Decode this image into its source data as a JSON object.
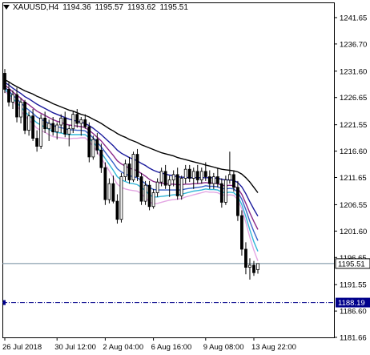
{
  "header": {
    "symbol": "XAUUSD,H4",
    "open": "1194.36",
    "high": "1195.57",
    "low": "1193.62",
    "close": "1195.51"
  },
  "colors": {
    "background": "#ffffff",
    "candle": "#000000",
    "price_line": "#6f8a9c",
    "level_line": "#00008b",
    "ma_black": "#000000",
    "ma_navy": "#1a1a9c",
    "ma_purple": "#8a2a8a",
    "ma_blue": "#3a62c9",
    "ma_cyan": "#34b7d8",
    "ma_pink": "#e3a6e3"
  },
  "chart_data": {
    "type": "candlestick",
    "ylim": [
      1181.66,
      1244.5
    ],
    "y_ticks": [
      "1241.65",
      "1236.70",
      "1231.60",
      "1226.65",
      "1221.55",
      "1216.60",
      "1211.65",
      "1206.55",
      "1201.60",
      "1196.65",
      "1191.55",
      "1186.60",
      "1181.66"
    ],
    "x_ticks": [
      "26 Jul 2018",
      "30 Jul 12:00",
      "2 Aug 04:00",
      "6 Aug 16:00",
      "9 Aug 08:00",
      "13 Aug 22:00"
    ],
    "current_price": {
      "label": "1195.51",
      "value": 1195.51
    },
    "level_line": {
      "label": "1188.19",
      "value": 1188.19
    },
    "candles": [
      [
        1231.2,
        1232.0,
        1227.5,
        1228.2
      ],
      [
        1228.2,
        1229.5,
        1225.0,
        1225.8
      ],
      [
        1225.8,
        1228.0,
        1224.5,
        1227.2
      ],
      [
        1227.2,
        1228.5,
        1222.0,
        1223.0
      ],
      [
        1223.0,
        1226.5,
        1221.8,
        1225.8
      ],
      [
        1225.8,
        1226.2,
        1219.8,
        1220.5
      ],
      [
        1220.5,
        1224.0,
        1219.5,
        1223.2
      ],
      [
        1223.2,
        1224.5,
        1218.5,
        1219.0
      ],
      [
        1219.0,
        1220.5,
        1216.5,
        1217.5
      ],
      [
        1217.5,
        1223.5,
        1217.0,
        1222.8
      ],
      [
        1222.8,
        1224.0,
        1220.0,
        1220.8
      ],
      [
        1220.8,
        1222.5,
        1218.5,
        1221.8
      ],
      [
        1221.8,
        1223.0,
        1219.5,
        1220.2
      ],
      [
        1220.2,
        1222.0,
        1218.8,
        1221.5
      ],
      [
        1221.5,
        1223.5,
        1220.0,
        1222.8
      ],
      [
        1222.8,
        1224.0,
        1219.2,
        1219.8
      ],
      [
        1219.8,
        1221.5,
        1217.5,
        1220.8
      ],
      [
        1220.8,
        1224.2,
        1220.0,
        1223.5
      ],
      [
        1223.5,
        1224.5,
        1221.0,
        1221.8
      ],
      [
        1221.8,
        1223.0,
        1219.5,
        1222.5
      ],
      [
        1222.5,
        1223.5,
        1220.8,
        1221.2
      ],
      [
        1221.2,
        1222.0,
        1214.5,
        1215.5
      ],
      [
        1215.5,
        1219.5,
        1215.0,
        1218.8
      ],
      [
        1218.8,
        1220.0,
        1216.0,
        1216.8
      ],
      [
        1216.8,
        1218.0,
        1212.5,
        1213.5
      ],
      [
        1213.5,
        1214.5,
        1206.5,
        1207.5
      ],
      [
        1207.5,
        1211.5,
        1206.8,
        1210.5
      ],
      [
        1210.5,
        1212.0,
        1206.8,
        1207.2
      ],
      [
        1207.2,
        1208.5,
        1203.0,
        1203.8
      ],
      [
        1203.8,
        1212.5,
        1203.2,
        1211.8
      ],
      [
        1211.8,
        1215.0,
        1211.0,
        1214.2
      ],
      [
        1214.2,
        1215.5,
        1210.5,
        1211.2
      ],
      [
        1211.2,
        1216.5,
        1210.8,
        1216.0
      ],
      [
        1216.0,
        1217.0,
        1211.0,
        1211.8
      ],
      [
        1211.8,
        1212.5,
        1206.5,
        1207.2
      ],
      [
        1207.2,
        1211.0,
        1206.5,
        1210.2
      ],
      [
        1210.2,
        1211.0,
        1205.5,
        1206.2
      ],
      [
        1206.2,
        1209.5,
        1205.8,
        1208.8
      ],
      [
        1208.8,
        1211.5,
        1208.0,
        1210.8
      ],
      [
        1210.8,
        1213.5,
        1210.0,
        1212.8
      ],
      [
        1212.8,
        1214.0,
        1209.5,
        1210.2
      ],
      [
        1210.2,
        1212.0,
        1208.0,
        1211.2
      ],
      [
        1211.2,
        1213.0,
        1210.0,
        1212.2
      ],
      [
        1212.2,
        1213.5,
        1207.5,
        1208.2
      ],
      [
        1208.2,
        1212.0,
        1207.5,
        1211.5
      ],
      [
        1211.5,
        1214.0,
        1210.5,
        1213.2
      ],
      [
        1213.2,
        1214.0,
        1210.8,
        1211.5
      ],
      [
        1211.5,
        1213.5,
        1209.5,
        1212.8
      ],
      [
        1212.8,
        1214.0,
        1210.5,
        1211.2
      ],
      [
        1211.2,
        1213.5,
        1210.5,
        1212.8
      ],
      [
        1212.8,
        1214.5,
        1211.0,
        1211.8
      ],
      [
        1211.8,
        1213.0,
        1209.5,
        1210.5
      ],
      [
        1210.5,
        1212.5,
        1209.5,
        1211.8
      ],
      [
        1211.8,
        1213.5,
        1209.8,
        1210.5
      ],
      [
        1210.5,
        1211.5,
        1206.0,
        1207.0
      ],
      [
        1207.0,
        1212.0,
        1206.5,
        1211.2
      ],
      [
        1211.2,
        1216.5,
        1210.5,
        1212.2
      ],
      [
        1212.2,
        1213.0,
        1209.0,
        1209.8
      ],
      [
        1209.8,
        1211.0,
        1203.5,
        1204.5
      ],
      [
        1204.5,
        1205.5,
        1197.0,
        1198.2
      ],
      [
        1198.2,
        1199.5,
        1193.5,
        1194.8
      ],
      [
        1194.8,
        1196.5,
        1192.5,
        1195.2
      ],
      [
        1195.2,
        1196.0,
        1193.2,
        1193.8
      ],
      [
        1194.36,
        1195.57,
        1193.62,
        1195.51
      ]
    ],
    "moving_averages": [
      {
        "color_key": "ma_black",
        "values": [
          1230.0,
          1229.6,
          1229.1,
          1228.7,
          1228.3,
          1227.9,
          1227.6,
          1227.3,
          1226.9,
          1226.6,
          1226.2,
          1225.9,
          1225.5,
          1225.2,
          1224.9,
          1224.6,
          1224.3,
          1224.1,
          1223.8,
          1223.5,
          1223.3,
          1223.0,
          1222.6,
          1222.2,
          1221.8,
          1221.3,
          1220.8,
          1220.4,
          1219.9,
          1219.5,
          1219.2,
          1218.8,
          1218.5,
          1218.2,
          1217.8,
          1217.5,
          1217.2,
          1216.9,
          1216.6,
          1216.3,
          1216.1,
          1215.9,
          1215.7,
          1215.4,
          1215.2,
          1215.0,
          1214.8,
          1214.6,
          1214.4,
          1214.2,
          1214.0,
          1213.8,
          1213.6,
          1213.4,
          1213.2,
          1213.1,
          1213.0,
          1212.9,
          1212.7,
          1212.3,
          1211.6,
          1210.8,
          1209.8,
          1208.8
        ]
      },
      {
        "color_key": "ma_navy",
        "values": [
          1229.5,
          1229.0,
          1228.4,
          1227.9,
          1227.4,
          1226.8,
          1226.4,
          1225.9,
          1225.4,
          1225.0,
          1224.6,
          1224.2,
          1223.8,
          1223.5,
          1223.2,
          1222.9,
          1222.6,
          1222.4,
          1222.2,
          1222.0,
          1221.8,
          1221.4,
          1220.9,
          1220.3,
          1219.7,
          1219.0,
          1218.3,
          1217.6,
          1216.8,
          1216.2,
          1215.8,
          1215.4,
          1215.1,
          1214.8,
          1214.3,
          1213.9,
          1213.4,
          1213.0,
          1212.7,
          1212.5,
          1212.3,
          1212.1,
          1212.0,
          1211.8,
          1211.7,
          1211.7,
          1211.6,
          1211.6,
          1211.6,
          1211.6,
          1211.6,
          1211.6,
          1211.6,
          1211.5,
          1211.3,
          1211.2,
          1211.2,
          1211.1,
          1210.7,
          1209.9,
          1208.6,
          1207.1,
          1205.7,
          1204.4
        ]
      },
      {
        "color_key": "ma_purple",
        "values": [
          1229.0,
          1228.4,
          1227.7,
          1227.1,
          1226.5,
          1225.8,
          1225.3,
          1224.7,
          1224.1,
          1223.7,
          1223.3,
          1222.9,
          1222.5,
          1222.2,
          1222.0,
          1221.7,
          1221.5,
          1221.4,
          1221.3,
          1221.2,
          1221.0,
          1220.5,
          1219.9,
          1219.2,
          1218.5,
          1217.6,
          1216.7,
          1215.8,
          1214.8,
          1214.2,
          1213.8,
          1213.4,
          1213.2,
          1212.9,
          1212.4,
          1211.9,
          1211.3,
          1210.9,
          1210.7,
          1210.6,
          1210.5,
          1210.4,
          1210.4,
          1210.3,
          1210.3,
          1210.4,
          1210.4,
          1210.5,
          1210.5,
          1210.6,
          1210.7,
          1210.6,
          1210.6,
          1210.5,
          1210.2,
          1210.1,
          1210.2,
          1210.1,
          1209.6,
          1208.5,
          1206.8,
          1205.0,
          1203.4,
          1201.9
        ]
      },
      {
        "color_key": "ma_blue",
        "values": [
          1228.6,
          1227.9,
          1227.1,
          1226.4,
          1225.7,
          1224.9,
          1224.3,
          1223.7,
          1223.0,
          1222.6,
          1222.2,
          1221.8,
          1221.4,
          1221.2,
          1221.0,
          1220.8,
          1220.6,
          1220.6,
          1220.5,
          1220.5,
          1220.4,
          1219.8,
          1219.1,
          1218.3,
          1217.4,
          1216.4,
          1215.4,
          1214.4,
          1213.3,
          1212.7,
          1212.3,
          1212.0,
          1211.8,
          1211.6,
          1211.1,
          1210.5,
          1209.8,
          1209.4,
          1209.3,
          1209.3,
          1209.3,
          1209.3,
          1209.3,
          1209.3,
          1209.3,
          1209.5,
          1209.6,
          1209.7,
          1209.8,
          1209.9,
          1210.1,
          1210.0,
          1210.0,
          1209.9,
          1209.6,
          1209.5,
          1209.6,
          1209.5,
          1208.9,
          1207.6,
          1205.6,
          1203.4,
          1201.5,
          1199.8
        ]
      },
      {
        "color_key": "ma_cyan",
        "values": [
          1228.2,
          1227.4,
          1226.5,
          1225.7,
          1224.9,
          1224.0,
          1223.3,
          1222.6,
          1221.9,
          1221.5,
          1221.1,
          1220.7,
          1220.3,
          1220.1,
          1220.0,
          1219.8,
          1219.7,
          1219.7,
          1219.7,
          1219.7,
          1219.7,
          1219.1,
          1218.3,
          1217.4,
          1216.3,
          1215.2,
          1214.1,
          1213.0,
          1211.8,
          1211.2,
          1210.9,
          1210.6,
          1210.5,
          1210.3,
          1209.8,
          1209.2,
          1208.4,
          1208.0,
          1208.0,
          1208.1,
          1208.2,
          1208.3,
          1208.4,
          1208.4,
          1208.5,
          1208.7,
          1208.9,
          1209.1,
          1209.2,
          1209.3,
          1209.5,
          1209.4,
          1209.4,
          1209.3,
          1208.9,
          1208.8,
          1208.9,
          1208.8,
          1208.1,
          1206.6,
          1204.3,
          1201.8,
          1199.6,
          1197.8
        ]
      },
      {
        "color_key": "ma_pink",
        "values": [
          1227.9,
          1227.0,
          1226.0,
          1225.1,
          1224.2,
          1223.2,
          1222.5,
          1221.7,
          1220.9,
          1220.5,
          1220.1,
          1219.7,
          1219.3,
          1219.2,
          1219.1,
          1219.0,
          1218.9,
          1219.0,
          1219.0,
          1219.1,
          1219.1,
          1218.4,
          1217.5,
          1216.5,
          1215.3,
          1214.1,
          1212.9,
          1211.7,
          1210.4,
          1209.8,
          1209.5,
          1209.3,
          1209.2,
          1209.1,
          1208.6,
          1207.9,
          1207.1,
          1206.7,
          1206.8,
          1207.0,
          1207.2,
          1207.4,
          1207.5,
          1207.6,
          1207.7,
          1208.0,
          1208.2,
          1208.4,
          1208.6,
          1208.8,
          1209.0,
          1208.9,
          1208.9,
          1208.8,
          1208.4,
          1208.3,
          1208.4,
          1208.3,
          1207.5,
          1205.8,
          1203.2,
          1200.4,
          1198.0,
          1196.0
        ]
      }
    ]
  }
}
